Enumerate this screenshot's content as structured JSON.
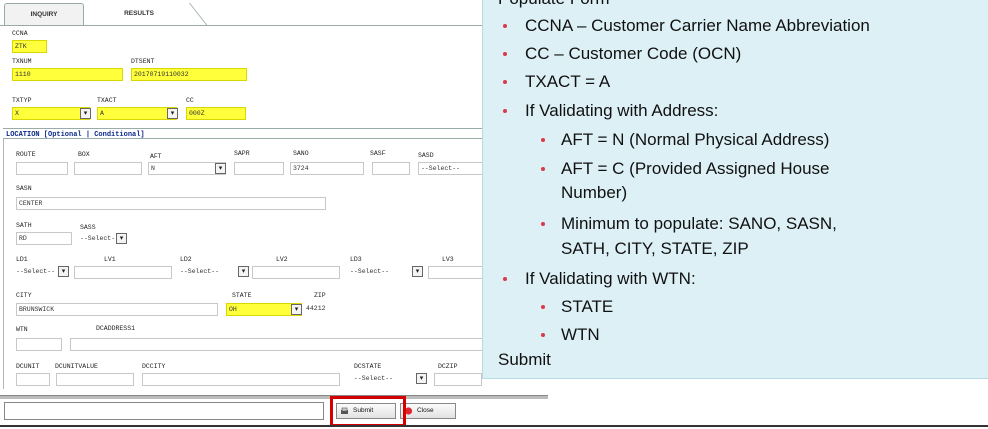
{
  "tabs": {
    "inquiry": "INQUIRY",
    "results": "RESULTS"
  },
  "form": {
    "ccna": {
      "label": "CCNA",
      "value": "ZTK"
    },
    "txnum": {
      "label": "TXNUM",
      "value": "1110"
    },
    "dtsent": {
      "label": "DTSENT",
      "value": "20170719110032"
    },
    "txtyp": {
      "label": "TXTYP",
      "value": "X"
    },
    "txact": {
      "label": "TXACT",
      "value": "A"
    },
    "cc": {
      "label": "CC",
      "value": "000Z"
    },
    "section_title": "LOCATION [Optional | Conditional]",
    "route": {
      "label": "ROUTE",
      "value": ""
    },
    "box": {
      "label": "BOX",
      "value": ""
    },
    "aft": {
      "label": "AFT",
      "value": "N"
    },
    "sapr": {
      "label": "SAPR",
      "value": ""
    },
    "sano": {
      "label": "SANO",
      "value": "3724"
    },
    "sasf": {
      "label": "SASF",
      "value": ""
    },
    "sasd": {
      "label": "SASD",
      "value": "--Select--"
    },
    "sasn": {
      "label": "SASN",
      "value": "CENTER"
    },
    "sath": {
      "label": "SATH",
      "value": "RD"
    },
    "sass": {
      "label": "SASS",
      "value": "--Select--"
    },
    "ld1": {
      "label": "LD1",
      "value": "--Select--"
    },
    "lv1": {
      "label": "LV1",
      "value": ""
    },
    "ld2": {
      "label": "LD2",
      "value": "--Select--"
    },
    "lv2": {
      "label": "LV2",
      "value": ""
    },
    "ld3": {
      "label": "LD3",
      "value": "--Select--"
    },
    "lv3": {
      "label": "LV3",
      "value": ""
    },
    "city": {
      "label": "CITY",
      "value": "BRUNSWICK"
    },
    "state": {
      "label": "STATE",
      "value": "OH"
    },
    "zip": {
      "label": "ZIP",
      "value": "44212"
    },
    "wtn": {
      "label": "WTN",
      "value": ""
    },
    "dcaddress1": {
      "label": "DCADDRESS1",
      "value": ""
    },
    "dcunit": {
      "label": "DCUNIT",
      "value": ""
    },
    "dcunitvalue": {
      "label": "DCUNITVALUE",
      "value": ""
    },
    "dccity": {
      "label": "DCCITY",
      "value": ""
    },
    "dcstate": {
      "label": "DCSTATE",
      "value": "--Select--"
    },
    "dczip": {
      "label": "DCZIP",
      "value": ""
    }
  },
  "buttons": {
    "submit": "Submit",
    "close": "Close"
  },
  "instructions": {
    "heading": "Populate Form",
    "items": [
      "CCNA – Customer Carrier Name Abbreviation",
      "CC – Customer Code (OCN)",
      "TXACT = A",
      "If Validating with Address:",
      "AFT = N (Normal Physical Address)",
      "AFT = C (Provided Assigned House",
      "Number)",
      "Minimum to populate:  SANO, SASN,",
      "SATH, CITY, STATE, ZIP",
      "If Validating with WTN:",
      "STATE",
      "WTN"
    ],
    "footer": "Submit"
  },
  "colors": {
    "highlight_yellow": "#ffff3c",
    "panel_bg": "#dcf0f6",
    "bullet_red": "#d9394a",
    "submit_highlight": "#d40000"
  }
}
